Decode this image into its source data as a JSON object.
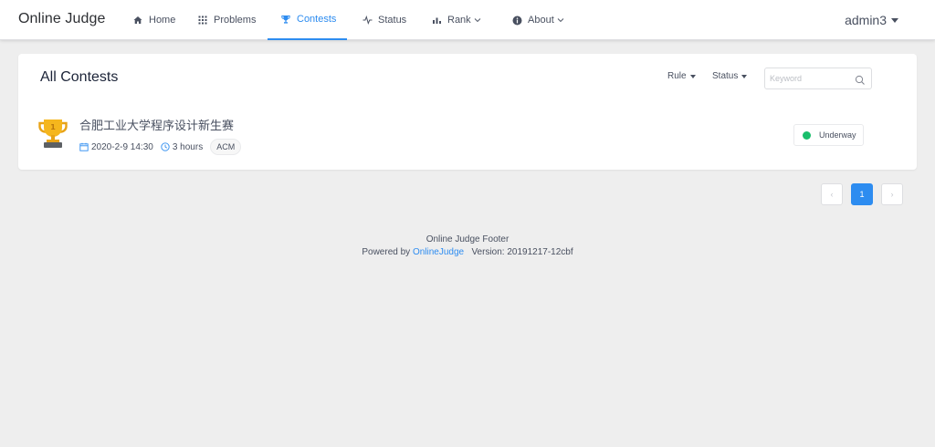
{
  "header": {
    "logo": "Online Judge",
    "nav": [
      {
        "label": "Home",
        "icon": "home-icon"
      },
      {
        "label": "Problems",
        "icon": "grid-icon"
      },
      {
        "label": "Contests",
        "icon": "trophy-icon",
        "active": true
      },
      {
        "label": "Status",
        "icon": "pulse-icon"
      },
      {
        "label": "Rank",
        "icon": "bar-chart-icon",
        "dropdown": true
      },
      {
        "label": "About",
        "icon": "info-icon",
        "dropdown": true
      }
    ],
    "user": "admin3"
  },
  "contests": {
    "title": "All Contests",
    "filters": {
      "rule": "Rule",
      "status": "Status"
    },
    "search": {
      "placeholder": "Keyword",
      "value": ""
    },
    "items": [
      {
        "title": "合肥工业大学程序设计新生赛",
        "start_time": "2020-2-9 14:30",
        "duration": "3 hours",
        "rule_type": "ACM",
        "status": "Underway",
        "status_color": "#19be6b"
      }
    ]
  },
  "pagination": {
    "current": "1",
    "prev": "‹",
    "next": "›"
  },
  "footer": {
    "line1": "Online Judge Footer",
    "powered_prefix": "Powered by",
    "powered_link": "OnlineJudge",
    "version": "Version: 20191217-12cbf"
  },
  "colors": {
    "accent": "#2d8cf0",
    "success": "#19be6b",
    "background": "#eeeeee"
  }
}
